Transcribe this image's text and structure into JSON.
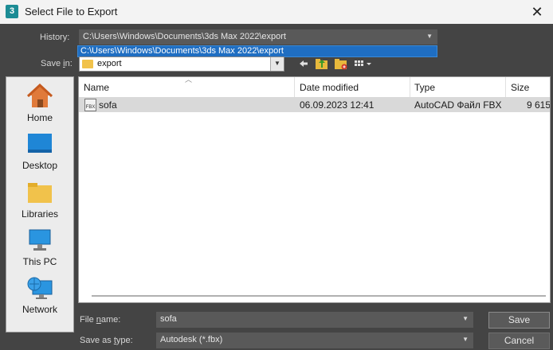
{
  "window": {
    "title": "Select File to Export",
    "app_icon_text": "3",
    "close_glyph": "✕"
  },
  "history": {
    "label": "History:",
    "value": "C:\\Users\\Windows\\Documents\\3ds Max 2022\\export",
    "dropdown_item": "C:\\Users\\Windows\\Documents\\3ds Max 2022\\export"
  },
  "save_in": {
    "label_pre": "Save ",
    "label_ul": "i",
    "label_post": "n:",
    "value": "export"
  },
  "places": [
    {
      "label": "Home",
      "icon": "home-icon"
    },
    {
      "label": "Desktop",
      "icon": "desktop-icon"
    },
    {
      "label": "Libraries",
      "icon": "libraries-icon"
    },
    {
      "label": "This PC",
      "icon": "this-pc-icon"
    },
    {
      "label": "Network",
      "icon": "network-icon"
    }
  ],
  "columns": {
    "name": "Name",
    "date": "Date modified",
    "type": "Type",
    "size": "Size"
  },
  "files": [
    {
      "name": "sofa",
      "date": "06.09.2023 12:41",
      "type": "AutoCAD Файл FBX",
      "size": "9 615",
      "icon_text": "FBX"
    }
  ],
  "file_name": {
    "label_pre": "File ",
    "label_ul": "n",
    "label_post": "ame:",
    "value": "sofa"
  },
  "save_as_type": {
    "label_pre": "Save as ",
    "label_ul": "t",
    "label_post": "ype:",
    "value": "Autodesk (*.fbx)"
  },
  "buttons": {
    "save": "Save",
    "cancel": "Cancel"
  },
  "colors": {
    "dialog_bg": "#444444",
    "selection": "#1f6ec2",
    "row_highlight": "#d9d9d9"
  }
}
